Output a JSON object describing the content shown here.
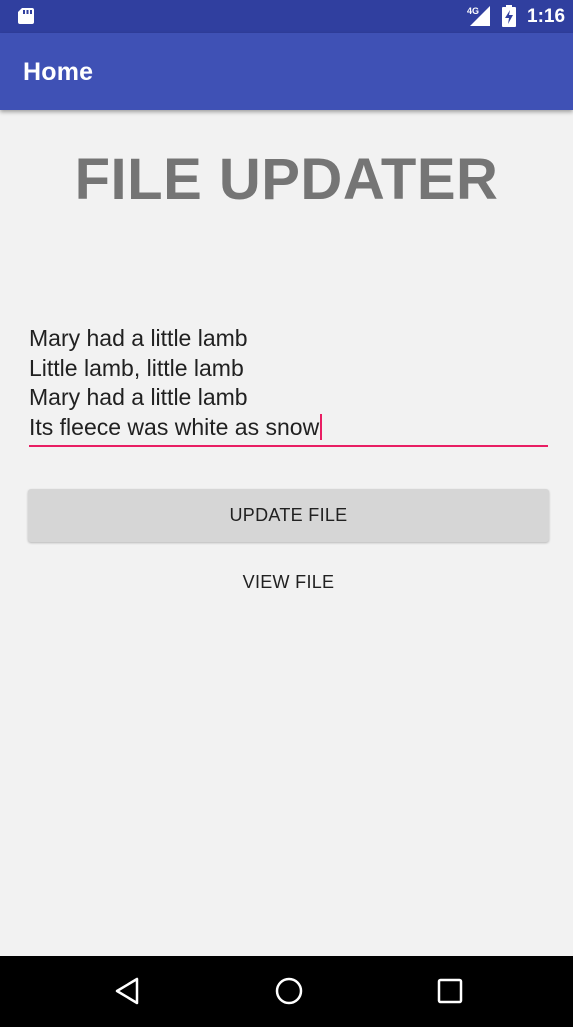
{
  "status_bar": {
    "time": "1:16",
    "network_label": "4G",
    "icons": [
      "sd-card-icon",
      "signal-icon",
      "battery-charging-icon"
    ]
  },
  "app_bar": {
    "title": "Home",
    "color": "#3f51b5",
    "status_color": "#303f9f"
  },
  "main": {
    "heading": "FILE UPDATER",
    "editor": {
      "lines": [
        "Mary had a little lamb",
        "Little lamb, little lamb",
        "Mary had a little lamb",
        "Its fleece was white as snow"
      ],
      "accent_color": "#e91e63"
    },
    "update_button_label": "UPDATE FILE",
    "view_button_label": "VIEW FILE"
  },
  "nav_bar": {
    "icons": [
      "back-icon",
      "home-icon",
      "recents-icon"
    ]
  }
}
